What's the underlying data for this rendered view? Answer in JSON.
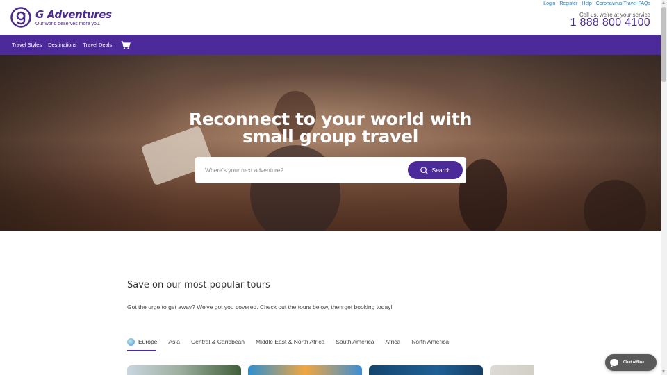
{
  "brand": {
    "name": "G Adventures",
    "tagline": "Our world deserves more you.",
    "color": "#4c2a99"
  },
  "top_links": [
    "Login",
    "Register",
    "Help",
    "Coronavirus Travel FAQs"
  ],
  "contact": {
    "call_text": "Call us, we're at your service",
    "phone": "1 888 800 4100"
  },
  "nav": {
    "items": [
      "Travel Styles",
      "Destinations",
      "Travel Deals"
    ],
    "cart_icon": "cart-icon"
  },
  "hero": {
    "title_line1": "Reconnect to your world with",
    "title_line2": "small group travel",
    "search_placeholder": "Where's your next adventure?",
    "search_button": "Search"
  },
  "popular": {
    "title": "Save on our most popular tours",
    "subtitle": "Got the urge to get away? We've got you covered. Check out the tours below, then get booking today!",
    "tabs": [
      "Europe",
      "Asia",
      "Central & Caribbean",
      "Middle East & North Africa",
      "South America",
      "Africa",
      "North America"
    ],
    "active_tab": "Europe"
  },
  "chat": {
    "label": "Chat offline"
  }
}
